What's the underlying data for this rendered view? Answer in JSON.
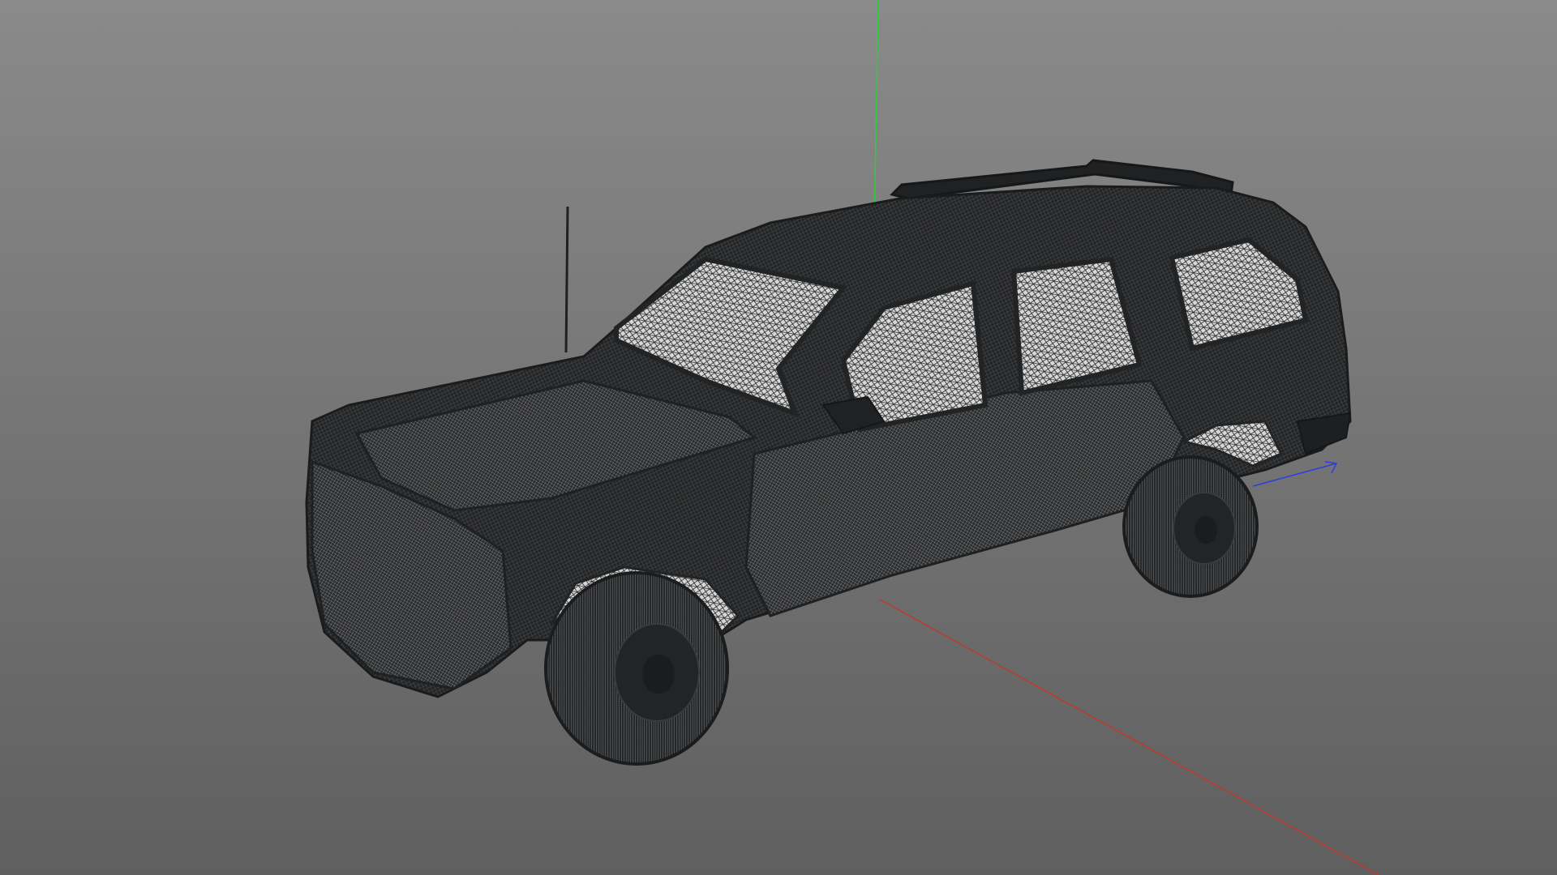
{
  "viewport": {
    "background_top": "#8a8a8a",
    "background_bottom": "#5f5f5f",
    "display_mode": "wireframe"
  },
  "gizmo": {
    "x_axis_color": "#c0392b",
    "y_axis_color": "#2ecc40",
    "z_axis_color": "#2c3ee0"
  },
  "model": {
    "kind": "suv-wireframe",
    "mesh_color": "#232425",
    "glass_color": "#e8e8e8"
  }
}
